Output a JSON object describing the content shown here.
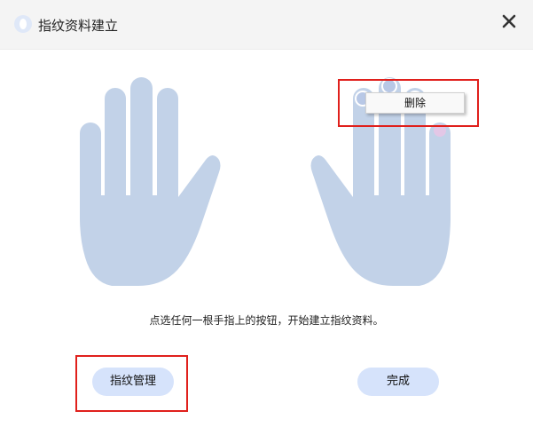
{
  "window": {
    "title": "指纹资料建立",
    "app_icon": "fingerprint-app-icon",
    "close_icon": "close-icon"
  },
  "hands": {
    "left": "left-hand-icon",
    "right": "right-hand-icon",
    "fill_color": "#c2d2e8",
    "enrolled_marker_color": "#b8c8e6"
  },
  "context_menu": {
    "delete_label": "删除"
  },
  "instruction_text": "点选任何一根手指上的按钮，开始建立指纹资料。",
  "buttons": {
    "manage_label": "指纹管理",
    "done_label": "完成"
  },
  "colors": {
    "button_bg": "#d6e3fb",
    "highlight": "#e0201c",
    "titlebar_bg": "#f4f4f4"
  }
}
